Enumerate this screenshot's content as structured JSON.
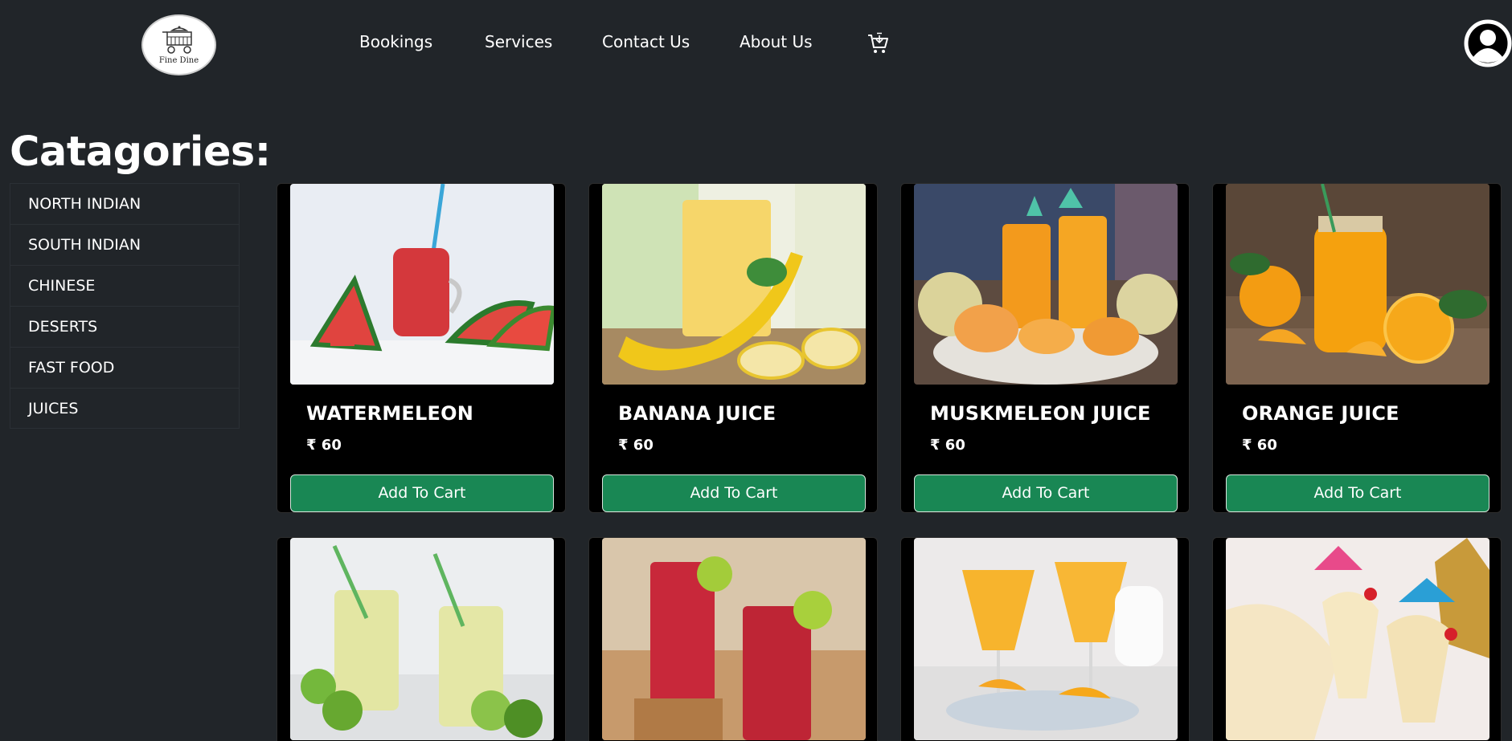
{
  "header": {
    "logo_text": "Fine Dine",
    "nav": [
      {
        "label": "Bookings"
      },
      {
        "label": "Services"
      },
      {
        "label": "Contact Us"
      },
      {
        "label": "About Us"
      }
    ]
  },
  "sidebar": {
    "title": "Catagories:",
    "items": [
      {
        "label": "NORTH INDIAN"
      },
      {
        "label": "SOUTH INDIAN"
      },
      {
        "label": "CHINESE"
      },
      {
        "label": "DESERTS"
      },
      {
        "label": "FAST FOOD"
      },
      {
        "label": "JUICES"
      }
    ]
  },
  "products": [
    {
      "name": "WATERMELEON",
      "price": "₹ 60",
      "button": "Add To Cart"
    },
    {
      "name": "BANANA JUICE",
      "price": "₹ 60",
      "button": "Add To Cart"
    },
    {
      "name": "MUSKMELEON JUICE",
      "price": "₹ 60",
      "button": "Add To Cart"
    },
    {
      "name": "ORANGE JUICE",
      "price": "₹ 60",
      "button": "Add To Cart"
    },
    {
      "name": "",
      "price": "",
      "button": ""
    },
    {
      "name": "",
      "price": "",
      "button": ""
    },
    {
      "name": "",
      "price": "",
      "button": ""
    },
    {
      "name": "",
      "price": "",
      "button": ""
    }
  ],
  "colors": {
    "background": "#212529",
    "card": "#000000",
    "button": "#198754"
  },
  "icons": [
    "cart-icon",
    "user-avatar-icon",
    "logo-cart-icon"
  ]
}
